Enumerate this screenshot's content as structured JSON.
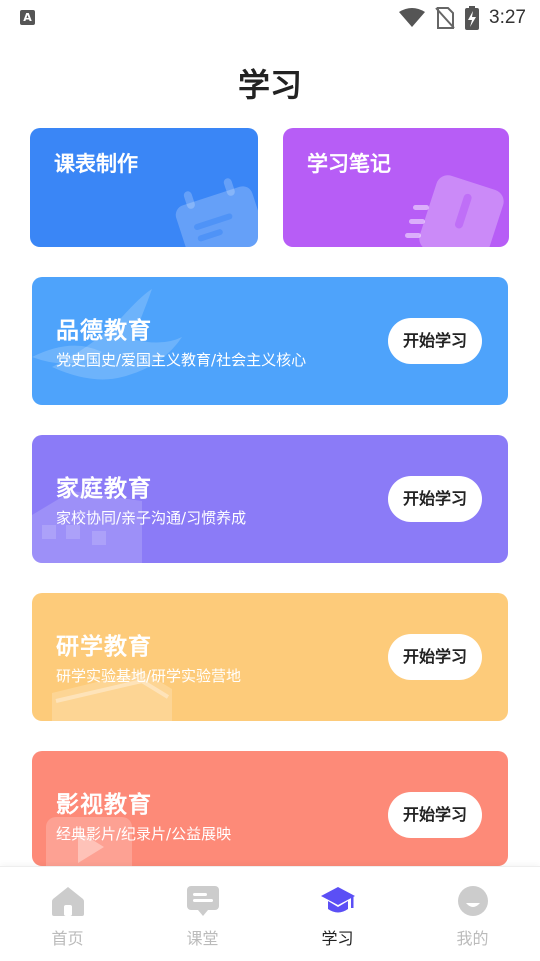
{
  "status_bar": {
    "left_icon_glyph": "A",
    "time": "3:27"
  },
  "page": {
    "title": "学习"
  },
  "tiles": [
    {
      "label": "课表制作",
      "color": "#3a86f6"
    },
    {
      "label": "学习笔记",
      "color": "#b75df6"
    }
  ],
  "cards": [
    {
      "title": "品德教育",
      "subtitle": "党史国史/爱国主义教育/社会主义核心",
      "button": "开始学习",
      "color": "#4ea3fb"
    },
    {
      "title": "家庭教育",
      "subtitle": "家校协同/亲子沟通/习惯养成",
      "button": "开始学习",
      "color": "#8b7bf7"
    },
    {
      "title": "研学教育",
      "subtitle": "研学实验基地/研学实验营地",
      "button": "开始学习",
      "color": "#fdcb7a"
    },
    {
      "title": "影视教育",
      "subtitle": "经典影片/纪录片/公益展映",
      "button": "开始学习",
      "color": "#fd8a78"
    }
  ],
  "nav": [
    {
      "label": "首页",
      "icon": "home-icon",
      "active": false
    },
    {
      "label": "课堂",
      "icon": "classroom-icon",
      "active": false
    },
    {
      "label": "学习",
      "icon": "graduation-cap-icon",
      "active": true
    },
    {
      "label": "我的",
      "icon": "profile-icon",
      "active": false
    }
  ],
  "colors": {
    "accent": "#5b4ff5",
    "inactive_nav": "#bbbbbb"
  }
}
